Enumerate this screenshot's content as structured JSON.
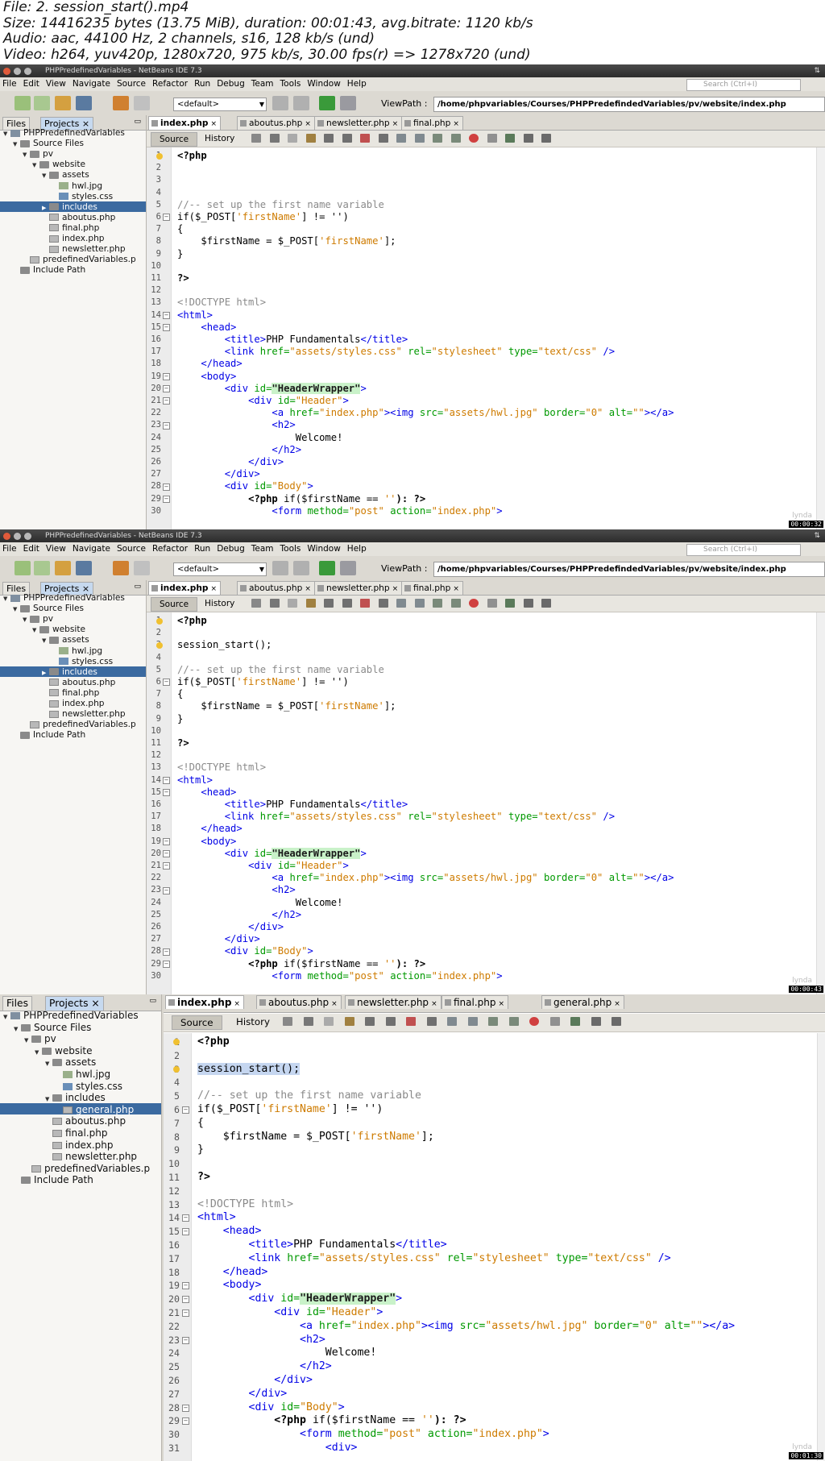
{
  "header": {
    "lines": [
      "File: 2. session_start().mp4",
      "Size: 14416235 bytes (13.75 MiB), duration: 00:01:43, avg.bitrate: 1120 kb/s",
      "Audio: aac, 44100 Hz, 2 channels, s16, 128 kb/s (und)",
      "Video: h264, yuv420p, 1280x720, 975 kb/s, 30.00 fps(r) => 1278x720 (und)"
    ]
  },
  "window": {
    "title": "PHPPredefinedVariables - NetBeans IDE 7.3",
    "menu": [
      "File",
      "Edit",
      "View",
      "Navigate",
      "Source",
      "Refactor",
      "Run",
      "Debug",
      "Team",
      "Tools",
      "Window",
      "Help"
    ],
    "search_placeholder": "Search (Ctrl+I)",
    "config": "<default>",
    "viewpath_label": "ViewPath :",
    "viewpath": "/home/phpvariables/Courses/PHPPredefindedVariables/pv/website/index.php"
  },
  "panel_tabs": {
    "files": "Files",
    "projects": "Projects"
  },
  "source_tabs": {
    "source": "Source",
    "history": "History"
  },
  "tree": {
    "project": "PHPPredefinedVariables",
    "source_files": "Source Files",
    "pv": "pv",
    "website": "website",
    "assets": "assets",
    "hwl": "hwl.jpg",
    "styles": "styles.css",
    "includes": "includes",
    "general": "general.php",
    "aboutus": "aboutus.php",
    "final": "final.php",
    "index": "index.php",
    "newsletter": "newsletter.php",
    "predefined": "predefinedVariables.p",
    "include_path": "Include Path"
  },
  "editor_tabs": [
    "index.php",
    "aboutus.php",
    "newsletter.php",
    "final.php",
    "general.php"
  ],
  "timestamps": [
    "00:00:32",
    "00:00:43",
    "00:01:30"
  ],
  "watermark": "lynda",
  "line_numbers": [
    "1",
    "2",
    "3",
    "4",
    "5",
    "6",
    "7",
    "8",
    "9",
    "10",
    "11",
    "12",
    "13",
    "14",
    "15",
    "16",
    "17",
    "18",
    "19",
    "20",
    "21",
    "22",
    "23",
    "24",
    "25",
    "26",
    "27",
    "28",
    "29",
    "30",
    "31"
  ],
  "code": {
    "php_open": "<?php",
    "php_close": "?>",
    "session": "session_start();",
    "comment": "//-- set up the first name variable",
    "if_open": "if($_POST[",
    "fn_str": "'firstName'",
    "if_close": "] != '')",
    "brace_open": "{",
    "assign": "$firstName = $_POST[",
    "assign_close": "];",
    "brace_close": "}",
    "doctype": "<!DOCTYPE html>",
    "html": "<html>",
    "head": "<head>",
    "title_open": "<title>",
    "title_text": "PHP Fundamentals",
    "title_close": "</title>",
    "link_tag": "<link",
    "href_attr": "href=",
    "css_path": "\"assets/styles.css\"",
    "rel_attr": "rel=",
    "rel_val": "\"stylesheet\"",
    "type_attr": "type=",
    "type_val": "\"text/css\"",
    "self_close": "/>",
    "head_close": "</head>",
    "body": "<body>",
    "div_open": "<div",
    "id_attr": "id=",
    "hw_id": "\"HeaderWrapper\"",
    "header_id": "\"Header\"",
    "gt": ">",
    "a_open": "<a",
    "index_href": "\"index.php\"",
    "img_open": "><img",
    "src_attr": "src=",
    "img_src": "\"assets/hwl.jpg\"",
    "border_attr": "border=",
    "border_val": "\"0\"",
    "alt_attr": "alt=",
    "alt_val": "\"\"",
    "a_close": "></a>",
    "h2": "<h2>",
    "welcome": "Welcome!",
    "h2_close": "</h2>",
    "div_close": "</div>",
    "body_id": "\"Body\"",
    "php_if": "<?php",
    "php_if_cond": "if($firstName ==",
    "empty_str": "''",
    "php_if_end": "): ?>",
    "form_open": "<form",
    "method_attr": "method=",
    "method_val": "\"post\"",
    "action_attr": "action=",
    "div_next": "<div>"
  }
}
